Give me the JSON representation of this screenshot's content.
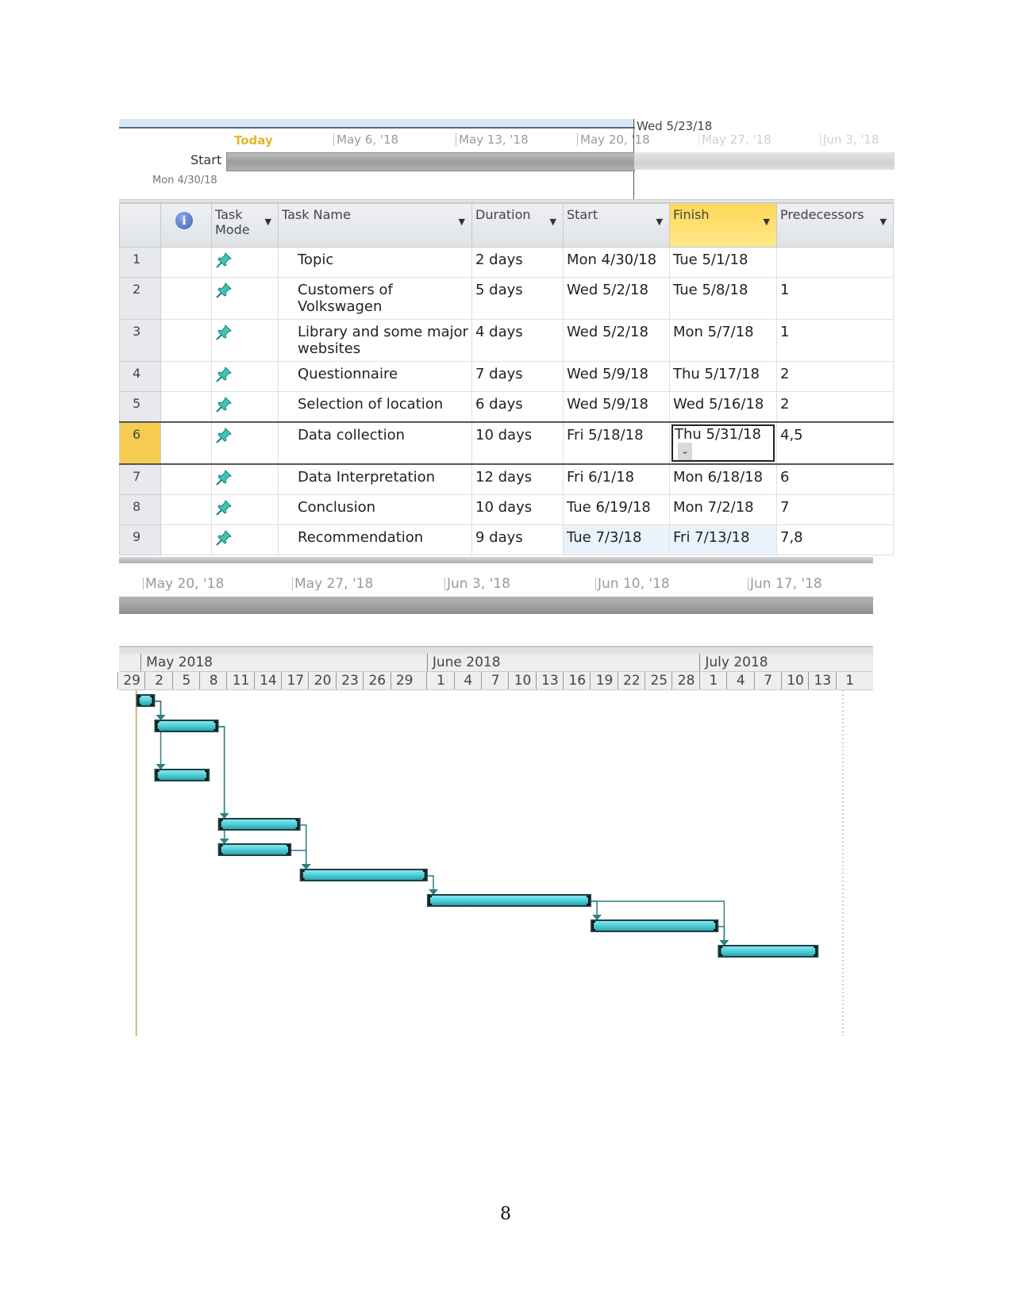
{
  "timeline": {
    "today_label": "Today",
    "start_label": "Start",
    "start_date": "Mon 4/30/18",
    "current_marker": "Wed 5/23/18",
    "ticks": [
      "May 6, '18",
      "May 13, '18",
      "May 20, '18",
      "May 27, '18",
      "Jun 3, '18"
    ]
  },
  "table": {
    "columns": [
      {
        "key": "id",
        "label": ""
      },
      {
        "key": "info",
        "label": "",
        "icon": "info-icon"
      },
      {
        "key": "mode",
        "label": "Task Mode"
      },
      {
        "key": "name",
        "label": "Task Name"
      },
      {
        "key": "duration",
        "label": "Duration"
      },
      {
        "key": "start",
        "label": "Start"
      },
      {
        "key": "finish",
        "label": "Finish"
      },
      {
        "key": "predecessors",
        "label": "Predecessors"
      }
    ],
    "highlighted_column": "Finish",
    "active_row": 6,
    "rows": [
      {
        "id": "1",
        "mode_icon": "pin-icon",
        "name": "Topic",
        "duration": "2 days",
        "start": "Mon 4/30/18",
        "finish": "Tue 5/1/18",
        "predecessors": ""
      },
      {
        "id": "2",
        "mode_icon": "pin-icon",
        "name": "Customers of Volkswagen",
        "duration": "5 days",
        "start": "Wed 5/2/18",
        "finish": "Tue 5/8/18",
        "predecessors": "1"
      },
      {
        "id": "3",
        "mode_icon": "pin-icon",
        "name": "Library and some major websites",
        "duration": "4 days",
        "start": "Wed 5/2/18",
        "finish": "Mon 5/7/18",
        "predecessors": "1"
      },
      {
        "id": "4",
        "mode_icon": "pin-icon",
        "name": "Questionnaire",
        "duration": "7 days",
        "start": "Wed 5/9/18",
        "finish": "Thu 5/17/18",
        "predecessors": "2"
      },
      {
        "id": "5",
        "mode_icon": "pin-icon",
        "name": "Selection of location",
        "duration": "6 days",
        "start": "Wed 5/9/18",
        "finish": "Wed 5/16/18",
        "predecessors": "2"
      },
      {
        "id": "6",
        "mode_icon": "pin-icon",
        "name": "Data collection",
        "duration": "10 days",
        "start": "Fri 5/18/18",
        "finish": "Thu 5/31/18",
        "predecessors": "4,5"
      },
      {
        "id": "7",
        "mode_icon": "pin-icon",
        "name": "Data Interpretation",
        "duration": "12 days",
        "start": "Fri 6/1/18",
        "finish": "Mon 6/18/18",
        "predecessors": "6"
      },
      {
        "id": "8",
        "mode_icon": "pin-icon",
        "name": "Conclusion",
        "duration": "10 days",
        "start": "Tue 6/19/18",
        "finish": "Mon 7/2/18",
        "predecessors": "7"
      },
      {
        "id": "9",
        "mode_icon": "pin-icon",
        "name": "Recommendation",
        "duration": "9 days",
        "start": "Tue 7/3/18",
        "finish": "Fri 7/13/18",
        "predecessors": "7,8"
      }
    ]
  },
  "scale2": {
    "ticks": [
      "May 20, '18",
      "May 27, '18",
      "Jun 3, '18",
      "Jun 10, '18",
      "Jun 17, '18"
    ]
  },
  "gantt": {
    "months": [
      "May 2018",
      "June 2018",
      "July 2018"
    ],
    "day_ticks": [
      "29",
      "2",
      "5",
      "8",
      "11",
      "14",
      "17",
      "20",
      "23",
      "26",
      "29",
      "1",
      "4",
      "7",
      "10",
      "13",
      "16",
      "19",
      "22",
      "25",
      "28",
      "1",
      "4",
      "7",
      "10",
      "13",
      "1"
    ],
    "bar_color": "#4fd0da",
    "link_color": "#2e7f7f"
  },
  "page_number": "8"
}
